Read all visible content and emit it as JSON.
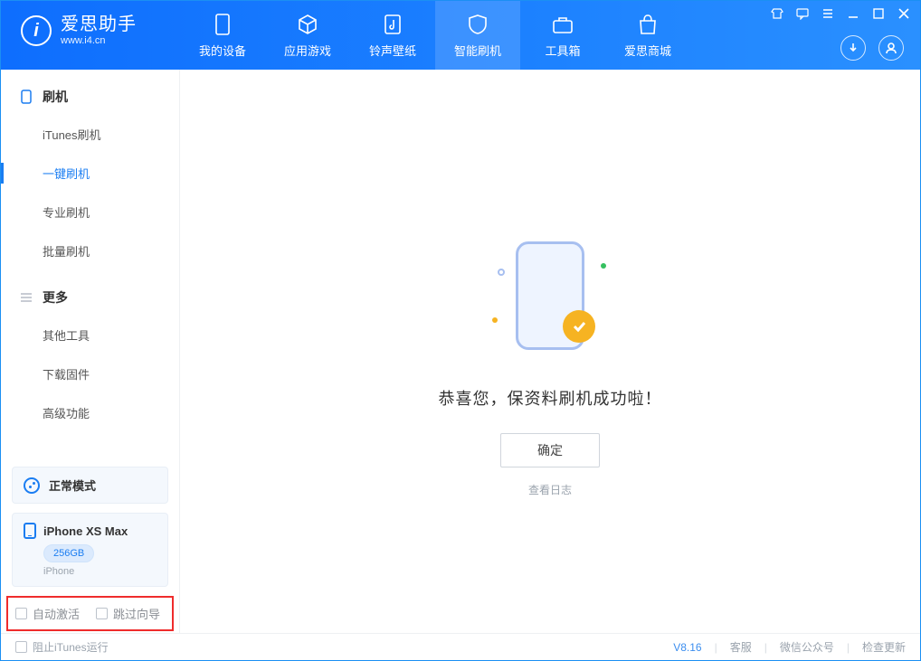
{
  "brand": {
    "title": "爱思助手",
    "subtitle": "www.i4.cn",
    "logo_letter": "i"
  },
  "top_tabs": [
    {
      "label": "我的设备"
    },
    {
      "label": "应用游戏"
    },
    {
      "label": "铃声壁纸"
    },
    {
      "label": "智能刷机"
    },
    {
      "label": "工具箱"
    },
    {
      "label": "爱思商城"
    }
  ],
  "sidebar": {
    "section1": {
      "title": "刷机",
      "items": [
        {
          "label": "iTunes刷机"
        },
        {
          "label": "一键刷机"
        },
        {
          "label": "专业刷机"
        },
        {
          "label": "批量刷机"
        }
      ]
    },
    "section2": {
      "title": "更多",
      "items": [
        {
          "label": "其他工具"
        },
        {
          "label": "下载固件"
        },
        {
          "label": "高级功能"
        }
      ]
    },
    "mode_label": "正常模式",
    "device": {
      "name": "iPhone XS Max",
      "storage": "256GB",
      "type": "iPhone"
    },
    "highlight_checks": {
      "auto_activate": "自动激活",
      "skip_setup": "跳过向导"
    }
  },
  "main": {
    "success_msg": "恭喜您，保资料刷机成功啦！",
    "ok_button": "确定",
    "log_link": "查看日志"
  },
  "statusbar": {
    "block_itunes": "阻止iTunes运行",
    "version": "V8.16",
    "links": {
      "support": "客服",
      "wechat": "微信公众号",
      "update": "检查更新"
    }
  }
}
